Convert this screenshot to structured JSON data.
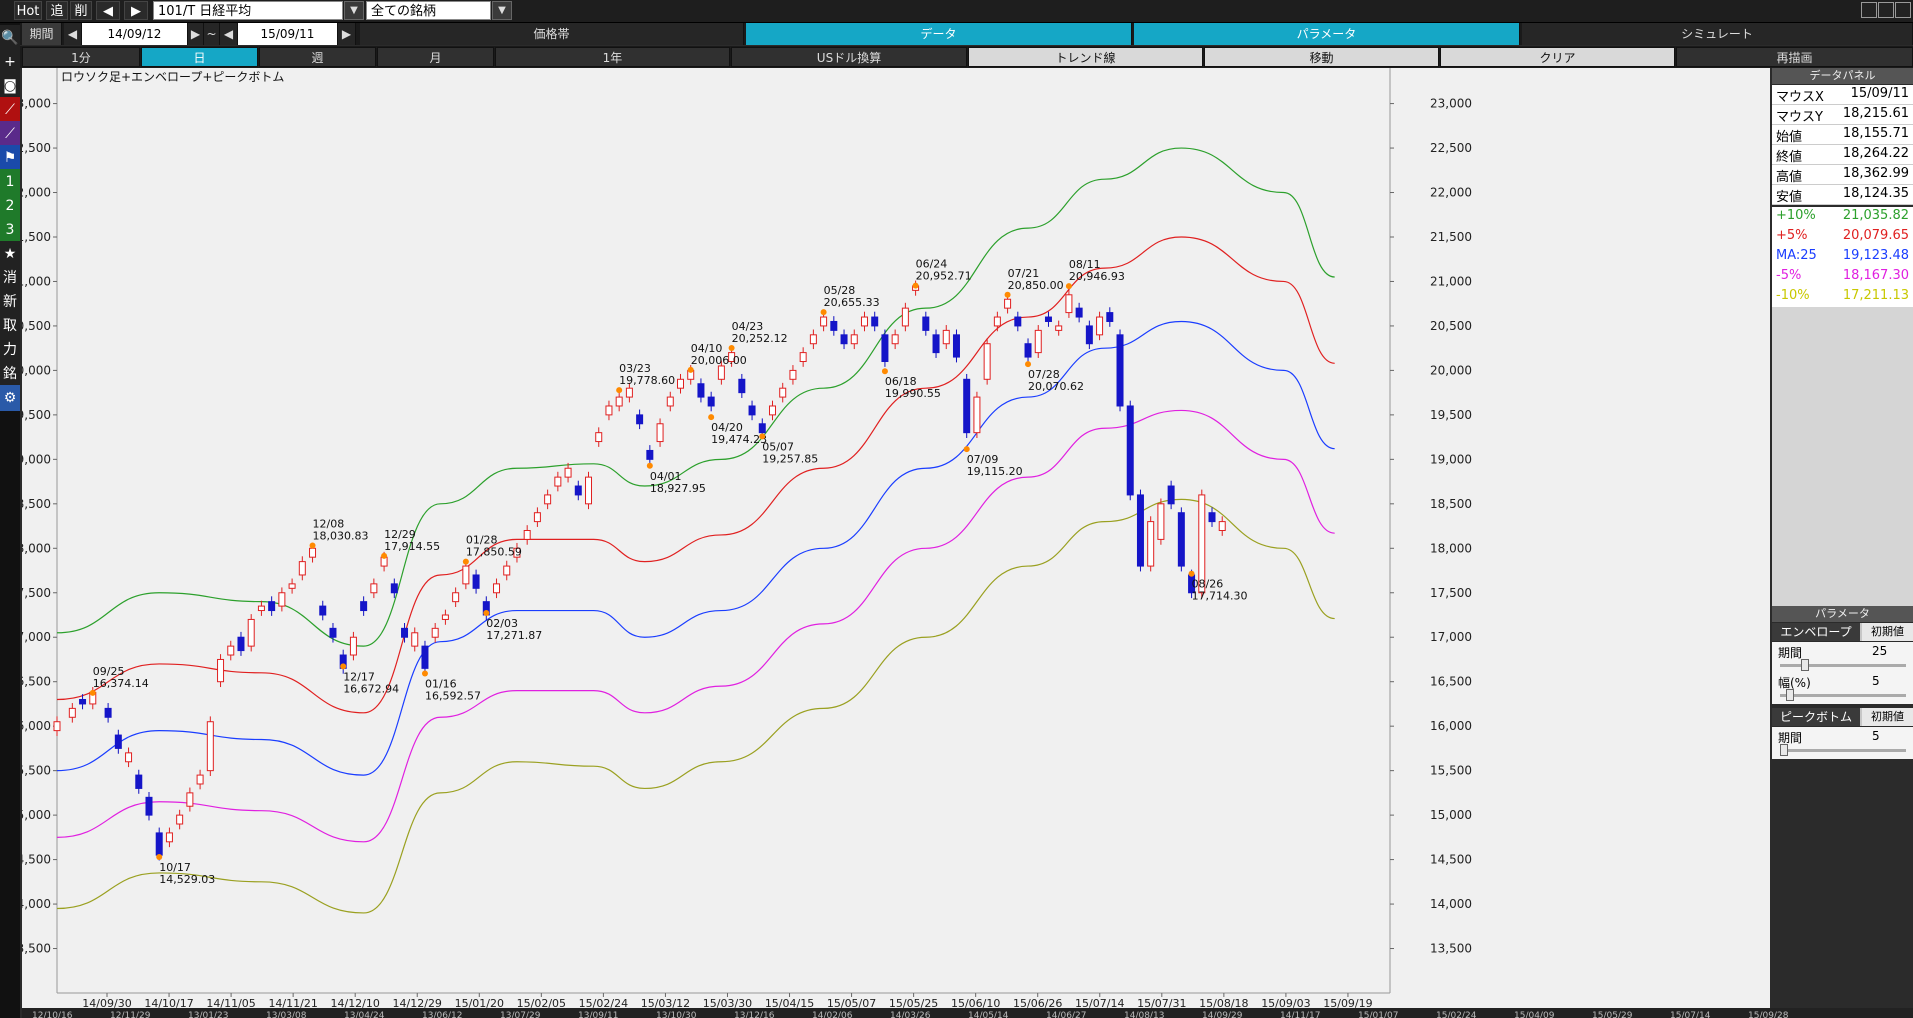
{
  "topbar": {
    "hot": "Hot",
    "add": "追",
    "del": "削",
    "symbol": "101/T 日経平均",
    "market": "全ての銘柄",
    "period_label": "期間",
    "date_from": "14/09/12",
    "tilde": "~",
    "date_to": "15/09/11"
  },
  "tabs": [
    "価格帯",
    "データ",
    "パラメータ",
    "シミュレート"
  ],
  "periods": [
    "1分",
    "日",
    "週",
    "月",
    "1年",
    "USドル換算",
    "トレンド線",
    "移動",
    "クリア",
    "再描画"
  ],
  "left_tools": [
    {
      "icon": "search-icon",
      "glyph": "🔍"
    },
    {
      "icon": "crosshair-icon",
      "glyph": "+"
    },
    {
      "icon": "camera-icon",
      "glyph": "◙"
    },
    {
      "icon": "line-chart-icon",
      "glyph": "⟋"
    },
    {
      "icon": "indicator-icon",
      "glyph": "⟋"
    },
    {
      "icon": "flag-icon",
      "glyph": "⚑"
    },
    {
      "icon": "number-1-icon",
      "glyph": "1"
    },
    {
      "icon": "number-2-icon",
      "glyph": "2"
    },
    {
      "icon": "number-3-icon",
      "glyph": "3"
    },
    {
      "icon": "star-icon",
      "glyph": "★"
    },
    {
      "icon": "erase-icon",
      "glyph": "消"
    },
    {
      "icon": "new-icon",
      "glyph": "新"
    },
    {
      "icon": "fetch-icon",
      "glyph": "取"
    },
    {
      "icon": "power-icon",
      "glyph": "力"
    },
    {
      "icon": "symbol-icon",
      "glyph": "銘"
    },
    {
      "icon": "gear-icon",
      "glyph": "⚙"
    }
  ],
  "data_panel": {
    "title": "データパネル",
    "rows": [
      {
        "k": "マウスX",
        "v": "15/09/11"
      },
      {
        "k": "マウスY",
        "v": "18,215.61"
      },
      {
        "k": "始値",
        "v": "18,155.71"
      },
      {
        "k": "終値",
        "v": "18,264.22"
      },
      {
        "k": "高値",
        "v": "18,362.99"
      },
      {
        "k": "安値",
        "v": "18,124.35"
      }
    ],
    "env_rows": [
      {
        "k": "+10%",
        "v": "21,035.82",
        "color": "#2ca02c"
      },
      {
        "k": "+5%",
        "v": "20,079.65",
        "color": "#e02020"
      },
      {
        "k": "MA:25",
        "v": "19,123.48",
        "color": "#1a3dff"
      },
      {
        "k": "-5%",
        "v": "18,167.30",
        "color": "#e020e0"
      },
      {
        "k": "-10%",
        "v": "17,211.13",
        "color": "#c8c800"
      }
    ]
  },
  "params": {
    "title": "パラメータ",
    "envelope": {
      "label": "エンベロープ",
      "reset": "初期値",
      "period_label": "期間",
      "period_value": "25",
      "period_pos": 0.18,
      "width_label": "幅(%)",
      "width_value": "5",
      "width_pos": 0.05
    },
    "peak": {
      "label": "ピークボトム",
      "reset": "初期値",
      "period_label": "期間",
      "period_value": "5",
      "period_pos": 0.0
    }
  },
  "chart_data": {
    "type": "line",
    "title": "ロウソク足+エンベロープ+ピークボトム",
    "ylim": [
      13000,
      23400
    ],
    "yticks": [
      13500,
      14000,
      14500,
      15000,
      15500,
      16000,
      16500,
      17000,
      17500,
      18000,
      18500,
      19000,
      19500,
      20000,
      20500,
      21000,
      21500,
      22000,
      22500,
      23000
    ],
    "ytick_labels": [
      "13,500",
      "14,000",
      "14,500",
      "15,000",
      "15,500",
      "16,000",
      "16,500",
      "17,000",
      "17,500",
      "18,000",
      "18,500",
      "19,000",
      "19,500",
      "20,000",
      "20,500",
      "21,000",
      "21,500",
      "22,000",
      "22,500",
      "23,000"
    ],
    "x_labels": [
      "14/09/30",
      "14/10/17",
      "14/11/05",
      "14/11/21",
      "14/12/10",
      "14/12/29",
      "15/01/20",
      "15/02/05",
      "15/02/24",
      "15/03/12",
      "15/03/30",
      "15/04/15",
      "15/05/07",
      "15/05/25",
      "15/06/10",
      "15/06/26",
      "15/07/14",
      "15/07/31",
      "15/08/18",
      "15/09/03",
      "15/09/19"
    ],
    "x_count": 254,
    "series": [
      {
        "name": "+10%",
        "color": "#2ca02c",
        "x": [
          0,
          20,
          40,
          60,
          75,
          90,
          105,
          115,
          130,
          150,
          170,
          190,
          205,
          220,
          240,
          250
        ],
        "values": [
          17050,
          17500,
          17400,
          16900,
          18500,
          18900,
          18950,
          18700,
          19000,
          19800,
          20700,
          21600,
          22150,
          22500,
          22000,
          21050
        ]
      },
      {
        "name": "+5%",
        "color": "#e02020",
        "x": [
          0,
          20,
          40,
          60,
          75,
          90,
          105,
          115,
          130,
          150,
          170,
          190,
          205,
          220,
          240,
          250
        ],
        "values": [
          16300,
          16700,
          16600,
          16150,
          17700,
          18100,
          18100,
          17850,
          18150,
          18900,
          19800,
          20600,
          21150,
          21500,
          21000,
          20080
        ]
      },
      {
        "name": "MA:25",
        "color": "#1a3dff",
        "x": [
          0,
          20,
          40,
          60,
          75,
          90,
          105,
          115,
          130,
          150,
          170,
          190,
          205,
          220,
          240,
          250
        ],
        "values": [
          15500,
          15950,
          15850,
          15450,
          16950,
          17300,
          17300,
          17000,
          17300,
          18000,
          18900,
          19700,
          20250,
          20550,
          20000,
          19120
        ]
      },
      {
        "name": "-5%",
        "color": "#e020e0",
        "x": [
          0,
          20,
          40,
          60,
          75,
          90,
          105,
          115,
          130,
          150,
          170,
          190,
          205,
          220,
          240,
          250
        ],
        "values": [
          14750,
          15150,
          15050,
          14700,
          16100,
          16400,
          16400,
          16150,
          16450,
          17150,
          18000,
          18800,
          19350,
          19550,
          19000,
          18170
        ]
      },
      {
        "name": "-10%",
        "color": "#9aa020",
        "x": [
          0,
          20,
          40,
          60,
          75,
          90,
          105,
          115,
          130,
          150,
          170,
          190,
          205,
          220,
          240,
          250
        ],
        "values": [
          13950,
          14350,
          14250,
          13900,
          15250,
          15600,
          15550,
          15300,
          15600,
          16200,
          17000,
          17800,
          18300,
          18550,
          18000,
          17210
        ]
      }
    ],
    "candles": [
      [
        0,
        15950,
        16050
      ],
      [
        3,
        16100,
        16200
      ],
      [
        5,
        16300,
        16250
      ],
      [
        7,
        16250,
        16380
      ],
      [
        10,
        16200,
        16100
      ],
      [
        12,
        15900,
        15750
      ],
      [
        14,
        15600,
        15700
      ],
      [
        16,
        15450,
        15300
      ],
      [
        18,
        15200,
        15000
      ],
      [
        20,
        14800,
        14550
      ],
      [
        22,
        14700,
        14800
      ],
      [
        24,
        14900,
        15000
      ],
      [
        26,
        15100,
        15250
      ],
      [
        28,
        15350,
        15450
      ],
      [
        30,
        15500,
        16050
      ],
      [
        32,
        16500,
        16750
      ],
      [
        34,
        16800,
        16900
      ],
      [
        36,
        17000,
        16850
      ],
      [
        38,
        16900,
        17200
      ],
      [
        40,
        17300,
        17350
      ],
      [
        42,
        17400,
        17300
      ],
      [
        44,
        17350,
        17500
      ],
      [
        46,
        17550,
        17600
      ],
      [
        48,
        17700,
        17850
      ],
      [
        50,
        17900,
        18000
      ],
      [
        52,
        17350,
        17250
      ],
      [
        54,
        17100,
        17000
      ],
      [
        56,
        16800,
        16650
      ],
      [
        58,
        16800,
        17000
      ],
      [
        60,
        17400,
        17300
      ],
      [
        62,
        17500,
        17600
      ],
      [
        64,
        17800,
        17900
      ],
      [
        66,
        17600,
        17500
      ],
      [
        68,
        17100,
        17000
      ],
      [
        70,
        16900,
        17050
      ],
      [
        72,
        16900,
        16650
      ],
      [
        74,
        17000,
        17100
      ],
      [
        76,
        17200,
        17250
      ],
      [
        78,
        17400,
        17500
      ],
      [
        80,
        17600,
        17800
      ],
      [
        82,
        17700,
        17550
      ],
      [
        84,
        17400,
        17250
      ],
      [
        86,
        17500,
        17600
      ],
      [
        88,
        17700,
        17800
      ],
      [
        90,
        17900,
        18000
      ],
      [
        92,
        18100,
        18200
      ],
      [
        94,
        18300,
        18400
      ],
      [
        96,
        18500,
        18600
      ],
      [
        98,
        18700,
        18800
      ],
      [
        100,
        18800,
        18900
      ],
      [
        102,
        18700,
        18600
      ],
      [
        104,
        18500,
        18800
      ],
      [
        106,
        19200,
        19300
      ],
      [
        108,
        19500,
        19600
      ],
      [
        110,
        19600,
        19700
      ],
      [
        112,
        19700,
        19800
      ],
      [
        114,
        19500,
        19400
      ],
      [
        116,
        19100,
        19000
      ],
      [
        118,
        19200,
        19400
      ],
      [
        120,
        19600,
        19700
      ],
      [
        122,
        19800,
        19900
      ],
      [
        124,
        19900,
        20000
      ],
      [
        126,
        19850,
        19700
      ],
      [
        128,
        19700,
        19600
      ],
      [
        130,
        19900,
        20050
      ],
      [
        132,
        20100,
        20200
      ],
      [
        134,
        19900,
        19750
      ],
      [
        136,
        19600,
        19500
      ],
      [
        138,
        19400,
        19300
      ],
      [
        140,
        19500,
        19600
      ],
      [
        142,
        19700,
        19800
      ],
      [
        144,
        19900,
        20000
      ],
      [
        146,
        20100,
        20200
      ],
      [
        148,
        20300,
        20400
      ],
      [
        150,
        20500,
        20600
      ],
      [
        152,
        20550,
        20450
      ],
      [
        154,
        20400,
        20300
      ],
      [
        156,
        20300,
        20400
      ],
      [
        158,
        20500,
        20600
      ],
      [
        160,
        20600,
        20500
      ],
      [
        162,
        20400,
        20100
      ],
      [
        164,
        20300,
        20400
      ],
      [
        166,
        20500,
        20700
      ],
      [
        168,
        20900,
        20950
      ],
      [
        170,
        20600,
        20450
      ],
      [
        172,
        20400,
        20200
      ],
      [
        174,
        20300,
        20450
      ],
      [
        176,
        20400,
        20150
      ],
      [
        178,
        19900,
        19300
      ],
      [
        180,
        19300,
        19700
      ],
      [
        182,
        19900,
        20300
      ],
      [
        184,
        20500,
        20600
      ],
      [
        186,
        20700,
        20800
      ],
      [
        188,
        20600,
        20500
      ],
      [
        190,
        20300,
        20150
      ],
      [
        192,
        20200,
        20450
      ],
      [
        194,
        20600,
        20550
      ],
      [
        196,
        20450,
        20500
      ],
      [
        198,
        20650,
        20850
      ],
      [
        200,
        20700,
        20600
      ],
      [
        202,
        20500,
        20300
      ],
      [
        204,
        20400,
        20600
      ],
      [
        206,
        20650,
        20550
      ],
      [
        208,
        20400,
        19600
      ],
      [
        210,
        19600,
        18600
      ],
      [
        212,
        18600,
        17800
      ],
      [
        214,
        17800,
        18300
      ],
      [
        216,
        18100,
        18500
      ],
      [
        218,
        18700,
        18500
      ],
      [
        220,
        18400,
        17800
      ],
      [
        222,
        17700,
        17500
      ],
      [
        224,
        17500,
        18600
      ],
      [
        226,
        18400,
        18300
      ],
      [
        228,
        18200,
        18300
      ]
    ],
    "peaks": [
      {
        "x": 7,
        "y": 16374.14,
        "date": "09/25",
        "val": "16,374.14",
        "pos": "above"
      },
      {
        "x": 20,
        "y": 14529.03,
        "date": "10/17",
        "val": "14,529.03",
        "pos": "below"
      },
      {
        "x": 50,
        "y": 18030.83,
        "date": "12/08",
        "val": "18,030.83",
        "pos": "above"
      },
      {
        "x": 56,
        "y": 16672.94,
        "date": "12/17",
        "val": "16,672.94",
        "pos": "below"
      },
      {
        "x": 64,
        "y": 17914.55,
        "date": "12/29",
        "val": "17,914.55",
        "pos": "above"
      },
      {
        "x": 72,
        "y": 16592.57,
        "date": "01/16",
        "val": "16,592.57",
        "pos": "below"
      },
      {
        "x": 80,
        "y": 17850.59,
        "date": "01/28",
        "val": "17,850.59",
        "pos": "above"
      },
      {
        "x": 84,
        "y": 17271.87,
        "date": "02/03",
        "val": "17,271.87",
        "pos": "below"
      },
      {
        "x": 110,
        "y": 19778.6,
        "date": "03/23",
        "val": "19,778.60",
        "pos": "above"
      },
      {
        "x": 116,
        "y": 18927.95,
        "date": "04/01",
        "val": "18,927.95",
        "pos": "below"
      },
      {
        "x": 124,
        "y": 20006.0,
        "date": "04/10",
        "val": "20,006.00",
        "pos": "above"
      },
      {
        "x": 128,
        "y": 19474.23,
        "date": "04/20",
        "val": "19,474.23",
        "pos": "below"
      },
      {
        "x": 132,
        "y": 20252.12,
        "date": "04/23",
        "val": "20,252.12",
        "pos": "above"
      },
      {
        "x": 138,
        "y": 19257.85,
        "date": "05/07",
        "val": "19,257.85",
        "pos": "below"
      },
      {
        "x": 150,
        "y": 20655.33,
        "date": "05/28",
        "val": "20,655.33",
        "pos": "above"
      },
      {
        "x": 162,
        "y": 19990.55,
        "date": "06/18",
        "val": "19,990.55",
        "pos": "below"
      },
      {
        "x": 168,
        "y": 20952.71,
        "date": "06/24",
        "val": "20,952.71",
        "pos": "above"
      },
      {
        "x": 178,
        "y": 19115.2,
        "date": "07/09",
        "val": "19,115.20",
        "pos": "below"
      },
      {
        "x": 186,
        "y": 20850.0,
        "date": "07/21",
        "val": "20,850.00",
        "pos": "above"
      },
      {
        "x": 190,
        "y": 20070.62,
        "date": "07/28",
        "val": "20,070.62",
        "pos": "below"
      },
      {
        "x": 198,
        "y": 20946.93,
        "date": "08/11",
        "val": "20,946.93",
        "pos": "above"
      },
      {
        "x": 222,
        "y": 17714.3,
        "date": "08/26",
        "val": "17,714.30",
        "pos": "below"
      }
    ]
  },
  "bottom_strip": [
    "12/10/16",
    "12/11/29",
    "13/01/23",
    "13/03/08",
    "13/04/24",
    "13/06/12",
    "13/07/29",
    "13/09/11",
    "13/10/30",
    "13/12/16",
    "14/02/06",
    "14/03/26",
    "14/05/14",
    "14/06/27",
    "14/08/13",
    "14/09/29",
    "14/11/17",
    "15/01/07",
    "15/02/24",
    "15/04/09",
    "15/05/29",
    "15/07/14",
    "15/09/28"
  ]
}
